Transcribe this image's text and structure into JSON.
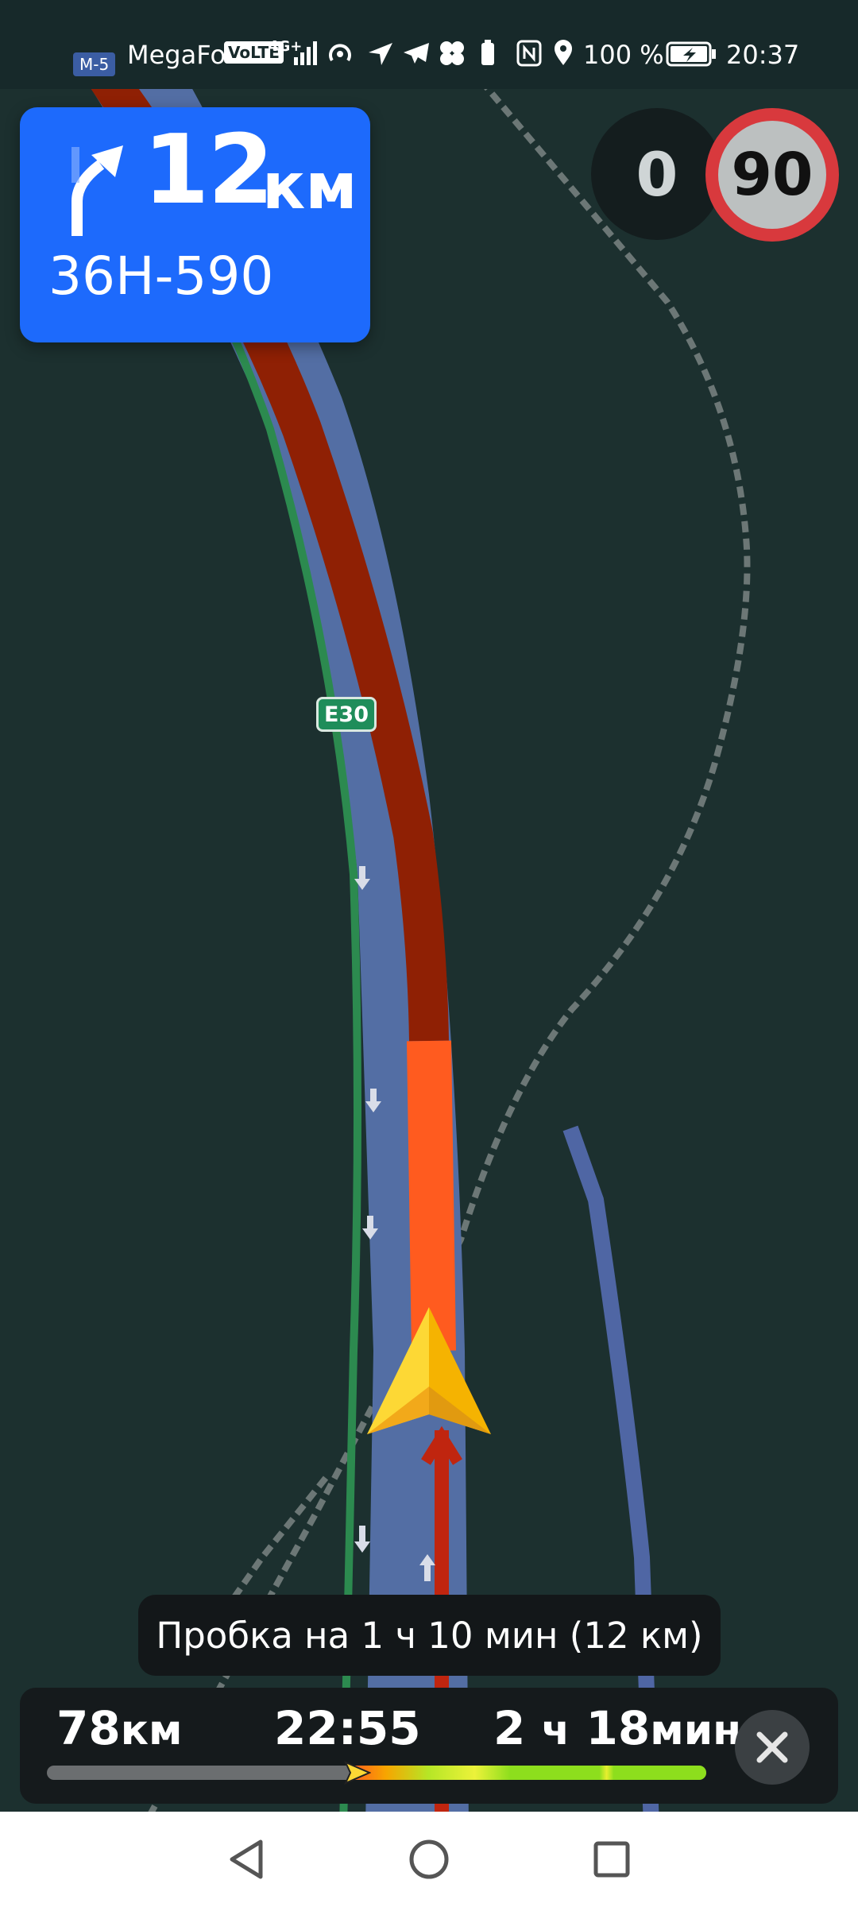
{
  "status_bar": {
    "carrier": "MegaFon",
    "volte": "VoLTE",
    "network": "4G+",
    "battery_percent": "100 %",
    "time": "20:37"
  },
  "map": {
    "top_route_badge": "M-5",
    "route_badge": "E30"
  },
  "maneuver": {
    "turn_icon": "turn-slight-right-icon",
    "distance_value": "12",
    "distance_unit": "км",
    "road_name": "36Н-590"
  },
  "speed": {
    "current": "0",
    "limit": "90"
  },
  "traffic_notice": "Пробка на 1 ч 10 мин (12 км)",
  "route_panel": {
    "distance_value": "78",
    "distance_unit": "км",
    "arrival_time": "22:55",
    "duration_hours": "2",
    "duration_hours_unit": "ч",
    "duration_minutes": "18",
    "duration_minutes_unit": "мин",
    "progress": 0.46
  },
  "colors": {
    "card_blue": "#1d6afc",
    "traffic_red": "#c0250f",
    "traffic_orange": "#ff5b1f",
    "speed_limit_red": "#d8393d"
  },
  "nav_bar": {
    "back_icon": "back-triangle-icon",
    "home_icon": "home-circle-icon",
    "recents_icon": "recents-square-icon"
  }
}
